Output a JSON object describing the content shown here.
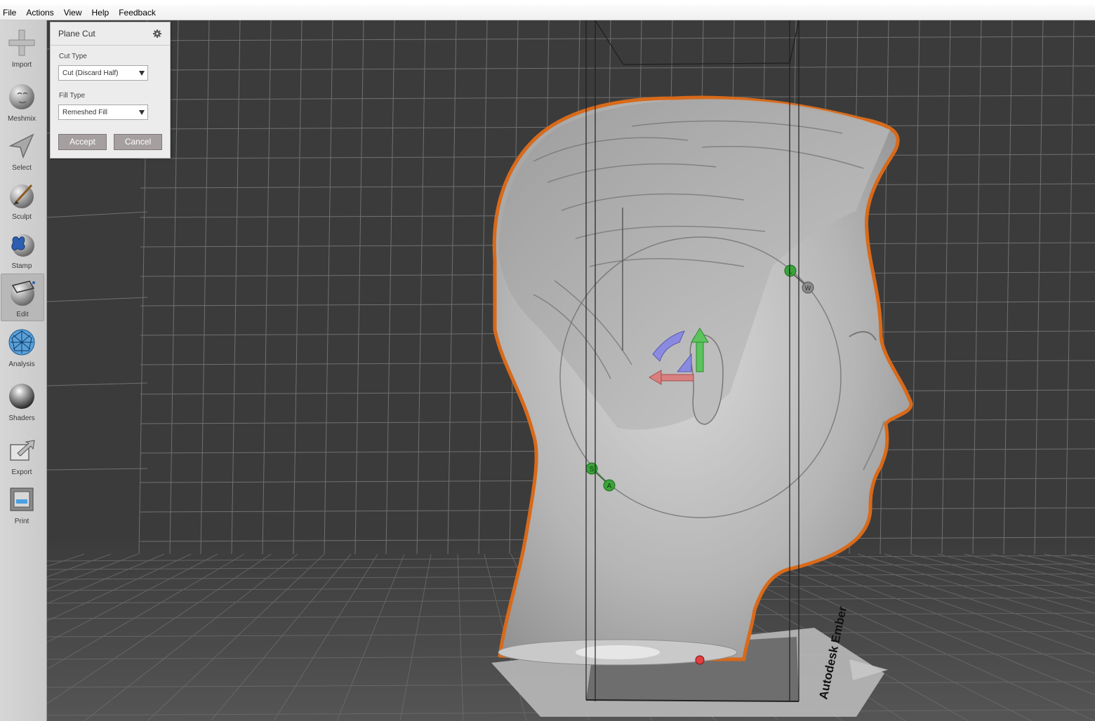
{
  "menu": [
    "File",
    "Actions",
    "View",
    "Help",
    "Feedback"
  ],
  "tools": [
    {
      "label": "Import",
      "icon": "plus-icon"
    },
    {
      "label": "Meshmix",
      "icon": "meshmix-head-icon"
    },
    {
      "label": "Select",
      "icon": "select-arrow-icon"
    },
    {
      "label": "Sculpt",
      "icon": "sculpt-brush-icon"
    },
    {
      "label": "Stamp",
      "icon": "stamp-icon"
    },
    {
      "label": "Edit",
      "icon": "edit-sphere-icon"
    },
    {
      "label": "Analysis",
      "icon": "analysis-mesh-icon"
    },
    {
      "label": "Shaders",
      "icon": "shader-sphere-icon"
    },
    {
      "label": "Export",
      "icon": "export-icon"
    },
    {
      "label": "Print",
      "icon": "printer-icon"
    }
  ],
  "panel": {
    "title": "Plane Cut",
    "cut_type_label": "Cut Type",
    "cut_type_value": "Cut (Discard Half)",
    "fill_type_label": "Fill Type",
    "fill_type_value": "Remeshed Fill",
    "accept_label": "Accept",
    "cancel_label": "Cancel"
  },
  "gizmo": {
    "handle_l": "L",
    "handle_w": "W",
    "handle_s": "S",
    "handle_a": "A"
  },
  "printer_label": "Autodesk Ember",
  "colors": {
    "cut_outline": "#d86a1a",
    "handle_green": "#3aa43a",
    "arrow_green": "#5cc45c",
    "arrow_red": "#d88080",
    "arc_blue": "#8a8ae0",
    "viewport_bg": "#3b3b3b"
  }
}
